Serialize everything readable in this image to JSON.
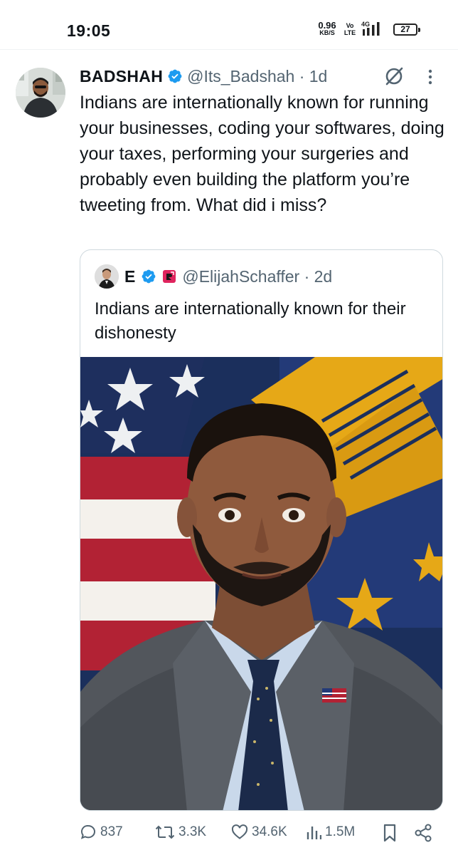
{
  "status_bar": {
    "time": "19:05",
    "net_speed_value": "0.96",
    "net_speed_unit": "KB/S",
    "volte_top": "Vo",
    "volte_bottom": "LTE",
    "network": "4G",
    "battery": "27"
  },
  "tweet": {
    "author_name": "BADSHAH",
    "handle_time": "@Its_Badshah · 1d",
    "text": "Indians are internationally known for running your businesses, coding your softwares, doing your taxes, performing your surgeries and probably even building the platform you’re tweeting from. What did i miss?",
    "stats": {
      "replies": "837",
      "reposts": "3.3K",
      "likes": "34.6K",
      "views": "1.5M"
    }
  },
  "quoted_tweet": {
    "author_name": "E",
    "handle_time": "@ElijahSchaffer · 2d",
    "text": "Indians are internationally known for their dishonesty"
  },
  "icons": {
    "verified": "verified-badge-icon",
    "affiliate": "affiliate-badge-icon",
    "grok": "grok-icon",
    "more": "more-options-icon",
    "reply": "reply-icon",
    "repost": "repost-icon",
    "like": "like-icon",
    "views": "views-icon",
    "bookmark": "bookmark-icon",
    "share": "share-icon"
  },
  "colors": {
    "verified_blue": "#1d9bf0",
    "text_primary": "#0f1419",
    "text_secondary": "#536471",
    "card_border": "#cfd9de",
    "affiliate_red": "#e0245e"
  }
}
